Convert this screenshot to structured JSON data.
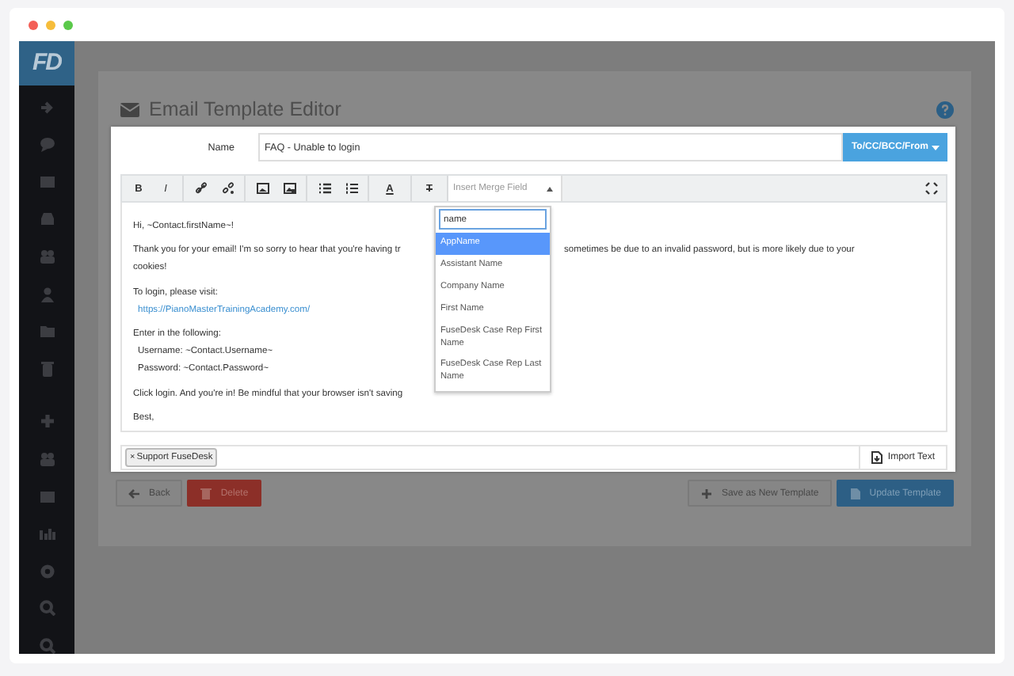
{
  "app": {
    "logo": "FD"
  },
  "page": {
    "title": "Email Template Editor",
    "buttons": [
      {
        "label": "Back",
        "kind": "back"
      },
      {
        "label": "Delete",
        "kind": "delete"
      },
      {
        "label": "Save as New Template",
        "kind": "save"
      },
      {
        "label": "Update Template",
        "kind": "update"
      }
    ]
  },
  "editor": {
    "name_label": "Name",
    "name_value": "FAQ - Unable to login",
    "recipients_button": "To/CC/BCC/From",
    "toolbar": {
      "groups": [
        [
          {
            "kind": "bold",
            "label": "B"
          },
          {
            "kind": "italic",
            "label": "I"
          }
        ],
        [
          {
            "kind": "link"
          },
          {
            "kind": "unlink"
          }
        ],
        [
          {
            "kind": "image"
          },
          {
            "kind": "photo"
          }
        ],
        [
          {
            "kind": "bullets"
          },
          {
            "kind": "numbers"
          }
        ],
        [
          {
            "kind": "text_color",
            "label": "A"
          }
        ],
        [
          {
            "kind": "clear_format",
            "label": "T"
          }
        ]
      ],
      "merge_field": {
        "placeholder": "Insert Merge Field",
        "expanded": true
      }
    },
    "merge_dropdown": {
      "search": "name",
      "options": [
        {
          "label": "AppName",
          "selected": true
        },
        {
          "label": "Assistant Name",
          "selected": false
        },
        {
          "label": "Company Name",
          "selected": false
        },
        {
          "label": "First Name",
          "selected": false
        },
        {
          "label": "FuseDesk Case Rep First Name",
          "selected": false
        },
        {
          "label": "FuseDesk Case Rep Last Name",
          "selected": false
        }
      ]
    },
    "body": [
      {
        "lines": [
          {
            "parts": [
              {
                "text": "Hi, ~Contact.firstName~!"
              }
            ]
          }
        ]
      },
      {
        "lines": [
          {
            "parts": [
              {
                "text": "Thank you for your email! I'm so sorry to hear that you're having tr"
              },
              {
                "text": "sometimes be due to an invalid password, but is more likely due to your"
              }
            ]
          },
          {
            "parts": [
              {
                "text": "cookies!"
              }
            ]
          }
        ]
      },
      {
        "lines": [
          {
            "parts": [
              {
                "text": "To login, please visit:"
              }
            ]
          },
          {
            "parts": [
              {
                "text": "https://PianoMasterTrainingAcademy.com/",
                "kind": "link"
              }
            ]
          }
        ]
      },
      {
        "lines": [
          {
            "parts": [
              {
                "text": "Enter in the following:"
              }
            ]
          },
          {
            "parts": [
              {
                "text": "Username: ~Contact.Username~",
                "kind": "indent"
              }
            ]
          },
          {
            "parts": [
              {
                "text": "Password: ~Contact.Password~",
                "kind": "indent"
              }
            ]
          }
        ]
      },
      {
        "lines": [
          {
            "parts": [
              {
                "text": "Click login. And you're in! Be mindful that your browser isn't saving"
              }
            ]
          }
        ]
      },
      {
        "lines": [
          {
            "parts": [
              {
                "text": "Best,"
              }
            ]
          }
        ]
      }
    ],
    "tags": [
      {
        "label": "Support FuseDesk",
        "remove": "×"
      }
    ],
    "import_button": "Import Text"
  }
}
